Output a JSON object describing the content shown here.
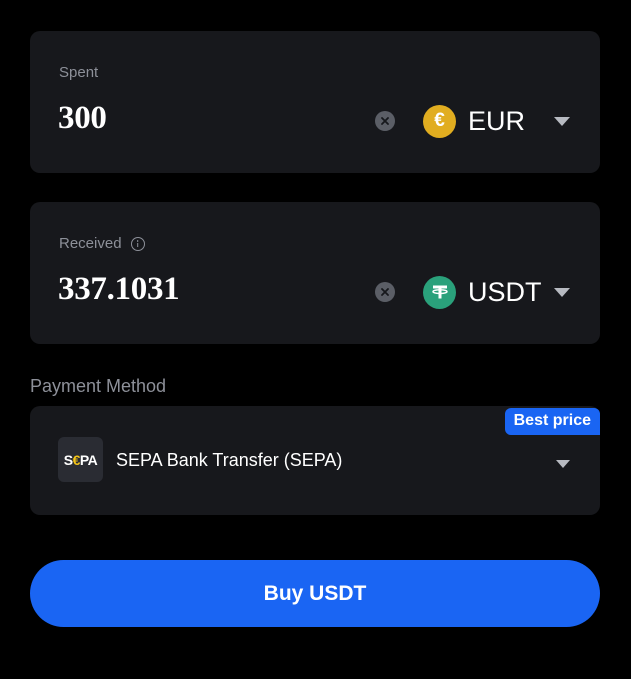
{
  "spent": {
    "label": "Spent",
    "amount": "300",
    "currency": {
      "code": "EUR",
      "symbol": "€",
      "icon": "euro-coin-icon",
      "color": "#e1ad20"
    }
  },
  "received": {
    "label": "Received",
    "amount": "337.1031",
    "currency": {
      "code": "USDT",
      "icon": "tether-coin-icon",
      "color": "#2aa17b"
    }
  },
  "payment": {
    "title": "Payment Method",
    "badge": "Best price",
    "logo": {
      "part1": "S",
      "part2": "€",
      "part3": "PA"
    },
    "method_name": "SEPA Bank Transfer (SEPA)"
  },
  "buy_button": {
    "label": "Buy USDT"
  },
  "colors": {
    "background": "#000000",
    "card": "#17181c",
    "accent": "#1a65f3",
    "muted_text": "#8d9099"
  }
}
